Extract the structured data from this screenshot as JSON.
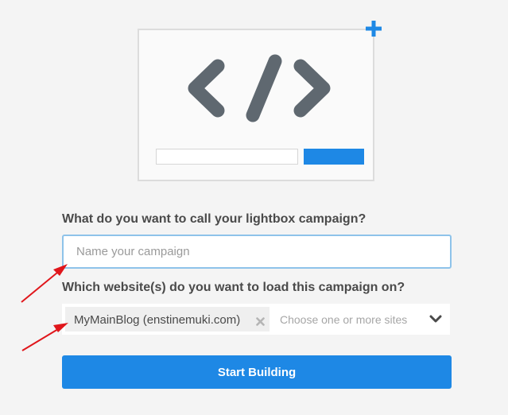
{
  "icons": {
    "illustration": "code-brackets-icon",
    "add": "plus-icon",
    "remove_tag": "close-icon",
    "dropdown": "chevron-down-icon",
    "annotation": "red-arrow"
  },
  "colors": {
    "accent": "#1e88e5",
    "code_glyph": "#5f6870",
    "annotation": "#e0161b",
    "input_focus_border": "#8ec3ea"
  },
  "form": {
    "name_label": "What do you want to call your lightbox campaign?",
    "name_input": {
      "value": "",
      "placeholder": "Name your campaign"
    },
    "sites_label": "Which website(s) do you want to load this campaign on?",
    "sites": {
      "selected": [
        "MyMainBlog (enstinemuki.com)"
      ],
      "placeholder": "Choose one or more sites"
    },
    "submit_label": "Start Building"
  }
}
